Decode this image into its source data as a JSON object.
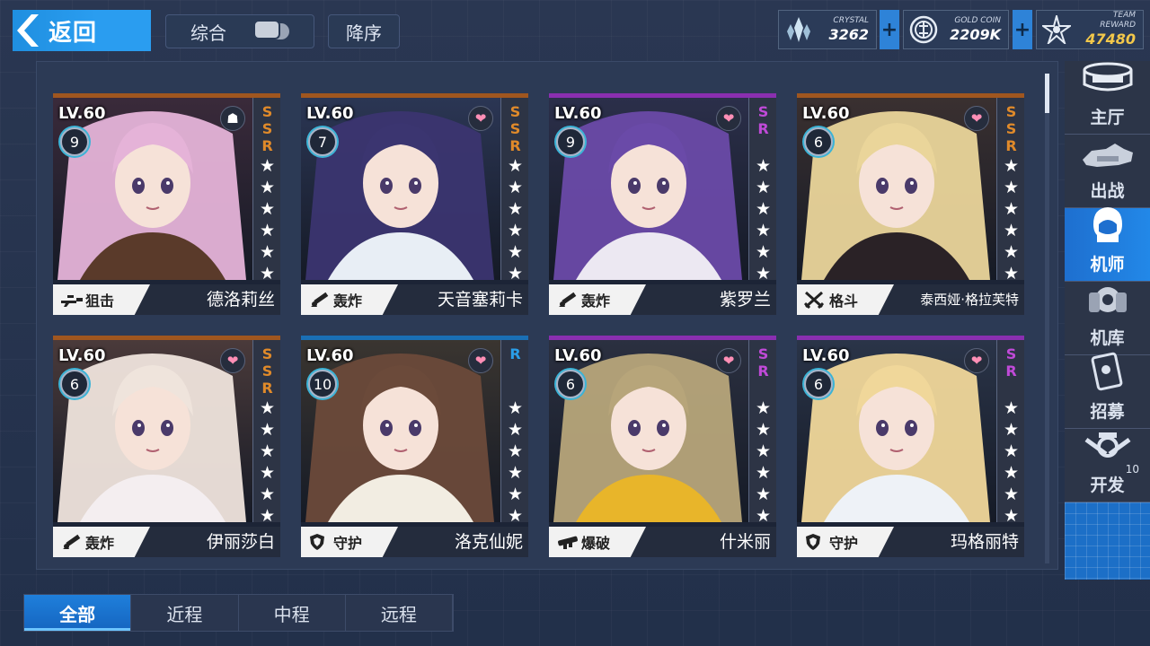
{
  "topbar": {
    "back_label": "返回",
    "sort_label": "综合",
    "order_label": "降序"
  },
  "resources": [
    {
      "caption": "CRYSTAL",
      "value": "3262",
      "icon": "crystal-icon",
      "value_color": "#ffffff"
    },
    {
      "caption": "GOLD COIN",
      "value": "2209K",
      "icon": "gold-coin-icon",
      "value_color": "#ffffff"
    },
    {
      "caption": "TEAM REWARD",
      "value": "47480",
      "icon": "team-reward-icon",
      "value_color": "#f3c84a"
    }
  ],
  "cards": [
    {
      "level": "LV.60",
      "rank": "9",
      "rarity": "SSR",
      "rarity_color": "#e08a2a",
      "top_color": "#a0561f",
      "badge": "emblem",
      "stars": 6,
      "class_name": "狙击",
      "class_icon": "sniper-icon",
      "name": "德洛莉丝",
      "hair": "#e5b3d8",
      "bg": "#3a2a3a",
      "outfit": "#5a3a2a"
    },
    {
      "level": "LV.60",
      "rank": "7",
      "rarity": "SSR",
      "rarity_color": "#e08a2a",
      "top_color": "#a0561f",
      "badge": "heart",
      "stars": 6,
      "class_name": "轰炸",
      "class_icon": "mortar-icon",
      "name": "天音塞莉卡",
      "hair": "#3b3570",
      "bg": "#2b3654",
      "outfit": "#e8eef5"
    },
    {
      "level": "LV.60",
      "rank": "9",
      "rarity": "SR",
      "rarity_color": "#c04ad8",
      "top_color": "#8a2fb0",
      "badge": "heart",
      "stars": 6,
      "class_name": "轰炸",
      "class_icon": "mortar-icon",
      "name": "紫罗兰",
      "hair": "#6a4aa8",
      "bg": "#2b2f4a",
      "outfit": "#ece8f2"
    },
    {
      "level": "LV.60",
      "rank": "6",
      "rarity": "SSR",
      "rarity_color": "#e08a2a",
      "top_color": "#a0561f",
      "badge": "heart",
      "stars": 6,
      "class_name": "格斗",
      "class_icon": "swords-icon",
      "name": "泰西娅·格拉芙特",
      "hair": "#ead59a",
      "bg": "#3a3030",
      "outfit": "#2a2226"
    },
    {
      "level": "LV.60",
      "rank": "6",
      "rarity": "SSR",
      "rarity_color": "#e08a2a",
      "top_color": "#a0561f",
      "badge": "heart",
      "stars": 6,
      "class_name": "轰炸",
      "class_icon": "mortar-icon",
      "name": "伊丽莎白",
      "hair": "#efe4dc",
      "bg": "#4a3a3a",
      "outfit": "#f4eef0"
    },
    {
      "level": "LV.60",
      "rank": "10",
      "rarity": "R",
      "rarity_color": "#2a9ee8",
      "top_color": "#1a6fb5",
      "badge": "heart",
      "stars": 6,
      "class_name": "守护",
      "class_icon": "shield-icon",
      "name": "洛克仙妮",
      "hair": "#6b4a3a",
      "bg": "#3a3530",
      "outfit": "#f2ede2"
    },
    {
      "level": "LV.60",
      "rank": "6",
      "rarity": "SR",
      "rarity_color": "#c04ad8",
      "top_color": "#8a2fb0",
      "badge": "heart",
      "stars": 6,
      "class_name": "爆破",
      "class_icon": "launcher-icon",
      "name": "什米丽",
      "hair": "#b7a57a",
      "bg": "#2b3040",
      "outfit": "#e8b52a"
    },
    {
      "level": "LV.60",
      "rank": "6",
      "rarity": "SR",
      "rarity_color": "#c04ad8",
      "top_color": "#8a2fb0",
      "badge": "heart",
      "stars": 6,
      "class_name": "守护",
      "class_icon": "shield-icon",
      "name": "玛格丽特",
      "hair": "#f0d79a",
      "bg": "#2a3448",
      "outfit": "#eef2f7"
    }
  ],
  "nav": [
    {
      "label": "主厅",
      "icon": "hall-icon",
      "active": false
    },
    {
      "label": "出战",
      "icon": "sortie-icon",
      "active": false
    },
    {
      "label": "机师",
      "icon": "pilot-icon",
      "active": true
    },
    {
      "label": "机库",
      "icon": "hangar-icon",
      "active": false
    },
    {
      "label": "招募",
      "icon": "recruit-icon",
      "active": false
    },
    {
      "label": "开发",
      "icon": "develop-icon",
      "active": false,
      "badge": "10"
    }
  ],
  "tabs": [
    {
      "label": "全部",
      "active": true
    },
    {
      "label": "近程",
      "active": false
    },
    {
      "label": "中程",
      "active": false
    },
    {
      "label": "远程",
      "active": false
    }
  ]
}
